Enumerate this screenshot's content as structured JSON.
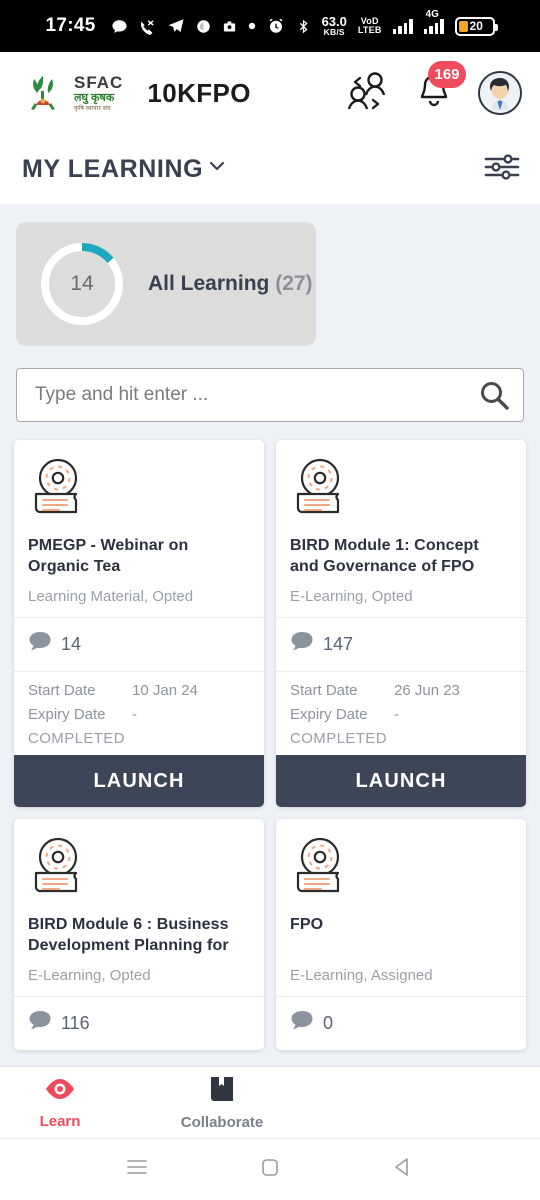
{
  "status_bar": {
    "time": "17:45",
    "icons": [
      "chat-bubble-icon",
      "missed-call-icon",
      "telegram-icon",
      "browser-icon",
      "camera-icon",
      "dot-icon",
      "alarm-icon",
      "bluetooth-icon"
    ],
    "network_speed_value": "63.0",
    "network_speed_unit": "KB/S",
    "volte_line1": "VoD",
    "volte_line2": "LTEB",
    "network_type": "4G",
    "battery_percent": "20"
  },
  "header": {
    "logo_name": "SFAC",
    "logo_hindi_main": "लघु कृषक",
    "logo_hindi_sub": "कृषि व्यापार संघ",
    "app_name": "10KFPO",
    "switch_user_icon": "user-switch-icon",
    "notification_icon": "bell-icon",
    "notification_count": "169",
    "avatar_icon": "user-avatar-icon"
  },
  "page": {
    "title": "MY LEARNING",
    "title_chevron": "chevron-down-icon",
    "filter_icon": "filter-sliders-icon"
  },
  "progress": {
    "completed": "14",
    "label": "All Learning",
    "total": "(27)",
    "arc_color": "#1fa8bd",
    "track_color": "#ffffff",
    "card_bg": "#dcdcdc",
    "percent": 14
  },
  "search": {
    "placeholder": "Type and hit enter ...",
    "value": "",
    "icon": "search-icon"
  },
  "courses": [
    {
      "icon": "cd-book-icon",
      "title": "PMEGP - Webinar on Organic Tea",
      "subtitle": "Learning Material, Opted",
      "comments_icon": "comment-icon",
      "comments": "14",
      "start_date_label": "Start Date",
      "start_date": "10 Jan 24",
      "expiry_date_label": "Expiry Date",
      "expiry_date": "-",
      "status": "COMPLETED",
      "action_label": "LAUNCH",
      "has_dates": true
    },
    {
      "icon": "cd-book-icon",
      "title": "BIRD Module 1: Concept and Governance of FPO",
      "subtitle": "E-Learning, Opted",
      "comments_icon": "comment-icon",
      "comments": "147",
      "start_date_label": "Start Date",
      "start_date": "26 Jun 23",
      "expiry_date_label": "Expiry Date",
      "expiry_date": "-",
      "status": "COMPLETED",
      "action_label": "LAUNCH",
      "has_dates": true
    },
    {
      "icon": "cd-book-icon",
      "title": "BIRD Module 6 : Business Development Planning for",
      "subtitle": "E-Learning, Opted",
      "comments_icon": "comment-icon",
      "comments": "116",
      "has_dates": false
    },
    {
      "icon": "cd-book-icon",
      "title": "FPO",
      "subtitle": "E-Learning, Assigned",
      "comments_icon": "comment-icon",
      "comments": "0",
      "has_dates": false
    }
  ],
  "bottom_nav": [
    {
      "icon": "eye-icon",
      "label": "Learn",
      "active": true,
      "color": "#ef4b5c"
    },
    {
      "icon": "book-icon",
      "label": "Collaborate",
      "active": false,
      "color": "#2f3640"
    }
  ],
  "android_nav": [
    "recents-icon",
    "home-icon",
    "back-icon"
  ]
}
